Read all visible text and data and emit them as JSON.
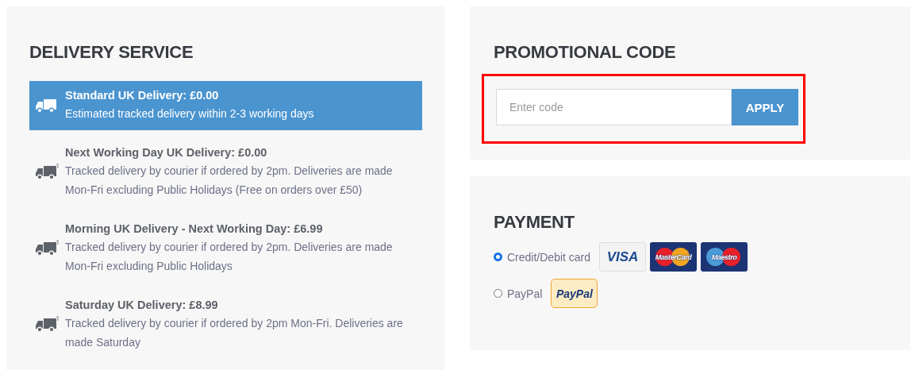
{
  "delivery": {
    "title": "DELIVERY SERVICE",
    "options": [
      {
        "name": "Standard UK Delivery: £0.00",
        "description": "Estimated tracked delivery within 2-3 working days",
        "selected": true
      },
      {
        "name": "Next Working Day UK Delivery: £0.00",
        "description": "Tracked delivery by courier if ordered by 2pm. Deliveries are made Mon-Fri excluding Public Holidays (Free on orders over £50)",
        "selected": false
      },
      {
        "name": "Morning UK Delivery - Next Working Day: £6.99",
        "description": "Tracked delivery by courier if ordered by 2pm. Deliveries are made Mon-Fri excluding Public Holidays",
        "selected": false
      },
      {
        "name": "Saturday UK Delivery: £8.99",
        "description": "Tracked delivery by courier if ordered by 2pm Mon-Fri. Deliveries are made Saturday",
        "selected": false
      }
    ]
  },
  "promo": {
    "title": "PROMOTIONAL CODE",
    "placeholder": "Enter code",
    "button": "APPLY",
    "highlighted": true
  },
  "payment": {
    "title": "PAYMENT",
    "methods": [
      {
        "label": "Credit/Debit card",
        "selected": true,
        "logos": [
          {
            "kind": "visa",
            "label": "VISA"
          },
          {
            "kind": "mastercard",
            "label": "MasterCard"
          },
          {
            "kind": "maestro",
            "label": "Maestro"
          }
        ]
      },
      {
        "label": "PayPal",
        "selected": false,
        "logos": [
          {
            "kind": "paypal",
            "label": "PayPal"
          }
        ]
      }
    ]
  }
}
